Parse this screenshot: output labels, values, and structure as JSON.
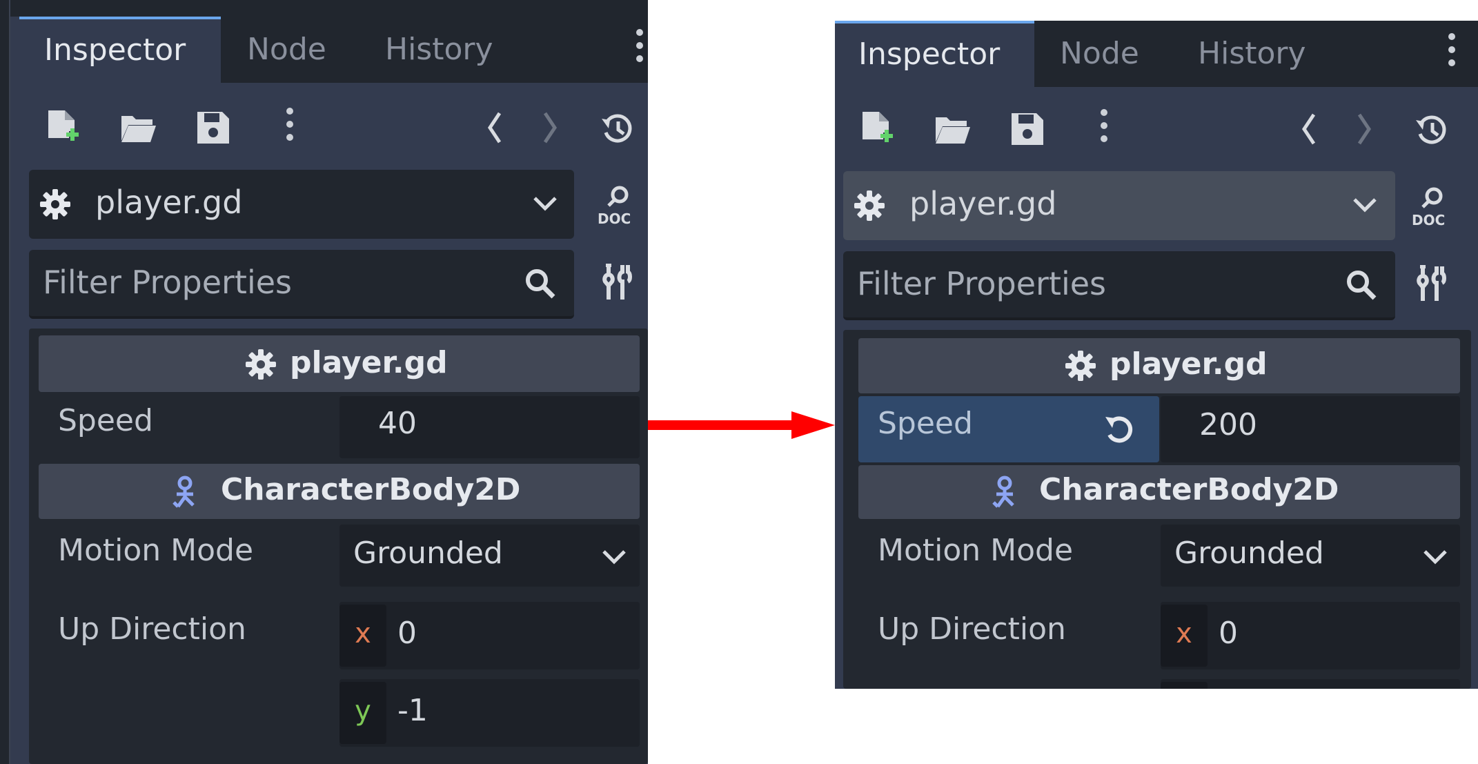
{
  "tabs": [
    "Inspector",
    "Node",
    "History"
  ],
  "script_selector": "player.gd",
  "filter_placeholder": "Filter Properties",
  "doc_label": "DOC",
  "sections": {
    "script": "player.gd",
    "class": "CharacterBody2D"
  },
  "properties": {
    "speed_label": "Speed",
    "motion_mode_label": "Motion Mode",
    "motion_mode_value": "Grounded",
    "up_direction_label": "Up Direction",
    "x_axis": "x",
    "y_axis": "y",
    "up_x": "0",
    "up_y": "-1"
  },
  "before": {
    "speed": "40"
  },
  "after": {
    "speed": "200"
  },
  "colors": {
    "panel": "#333b4f",
    "tab_accent": "#6aa6ec",
    "arrow": "#ff0000",
    "node_icon": "#8da5f3",
    "x_axis": "#e07b53",
    "y_axis": "#7ec856"
  }
}
